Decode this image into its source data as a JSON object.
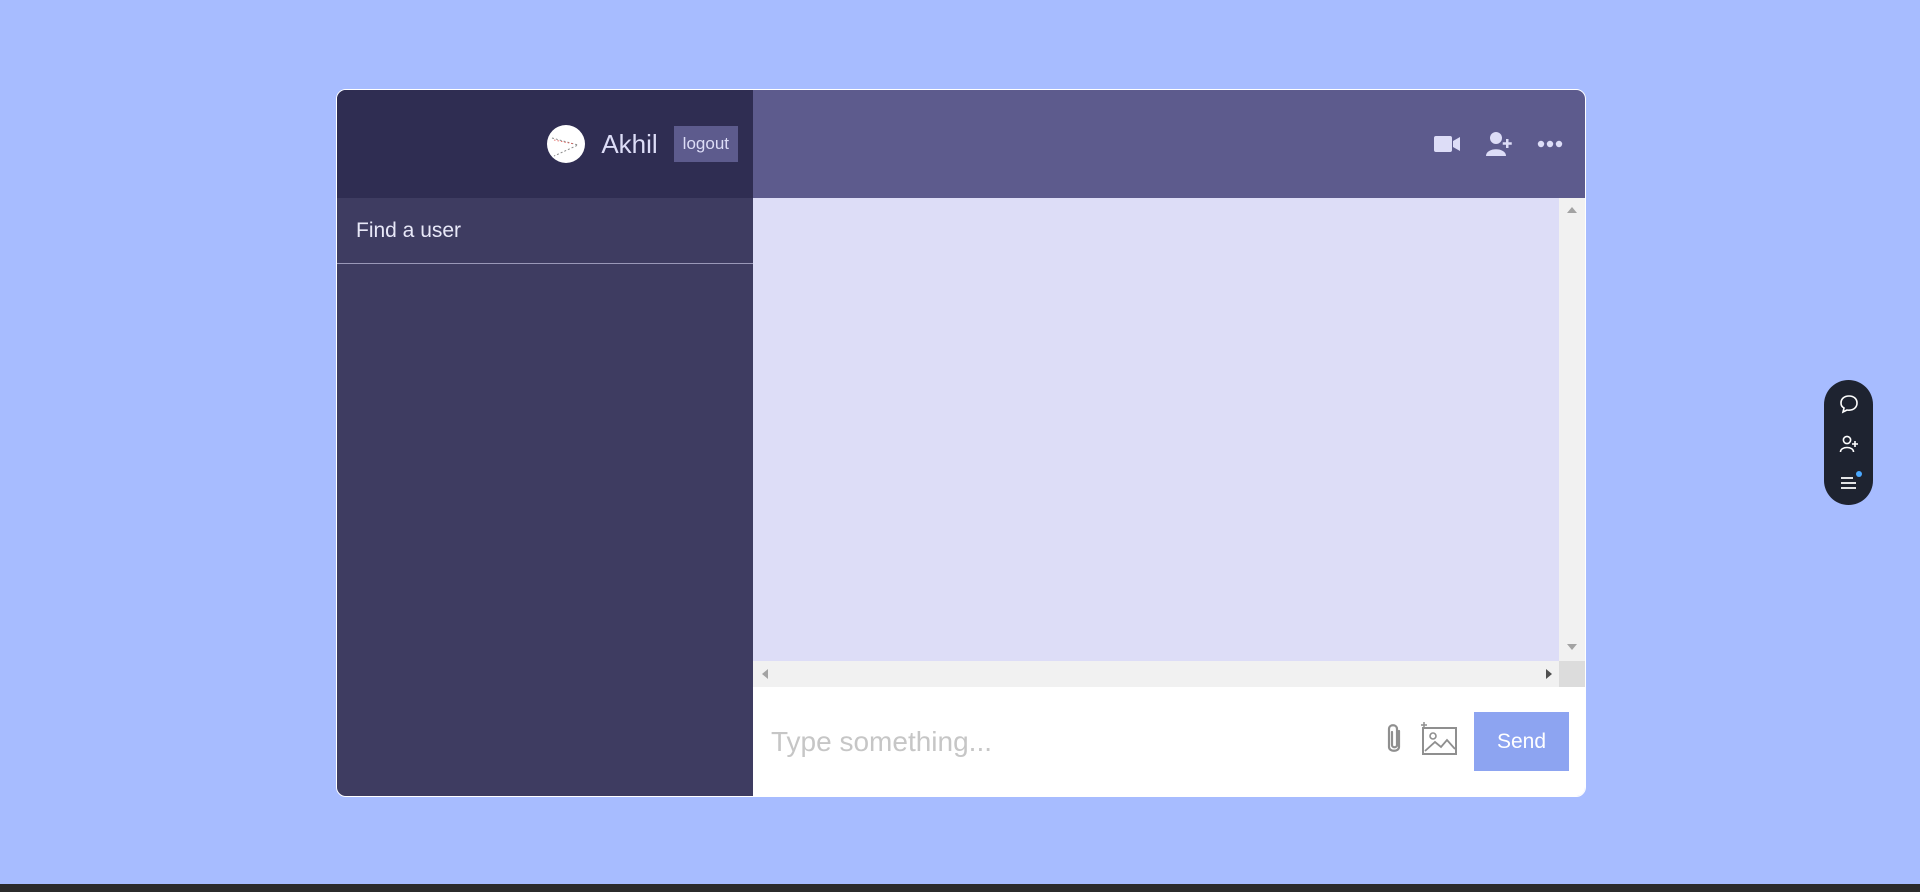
{
  "navbar": {
    "username": "Akhil",
    "logout_label": "logout"
  },
  "search": {
    "placeholder": "Find a user"
  },
  "chat_header": {
    "icons": [
      "video-camera-icon",
      "add-user-icon",
      "more-icon"
    ]
  },
  "composer": {
    "placeholder": "Type something...",
    "send_label": "Send",
    "icons": [
      "attach-icon",
      "image-icon"
    ]
  },
  "floating_widget": {
    "icons": [
      "chat-bubble-icon",
      "add-user-icon",
      "menu-list-icon"
    ]
  },
  "colors": {
    "page_background": "#a7bcff",
    "sidebar": "#3e3c61",
    "navbar": "#2f2d52",
    "chat_header": "#5d5b8d",
    "messages": "#ddddf7",
    "send_button": "#8da4f1"
  }
}
